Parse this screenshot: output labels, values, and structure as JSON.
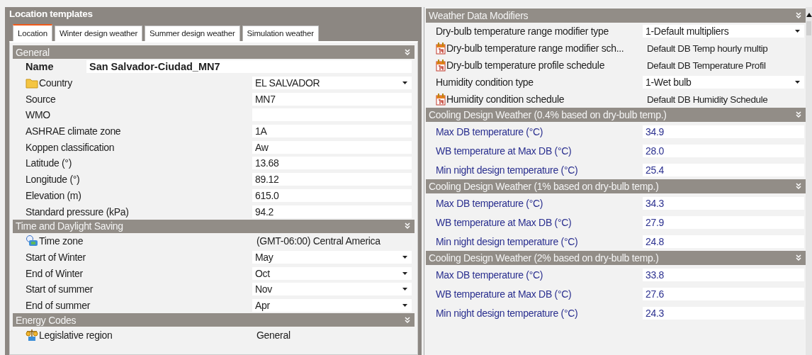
{
  "title": "Location templates",
  "tabs": [
    {
      "label": "Location",
      "selected": true
    },
    {
      "label": "Winter design weather",
      "selected": false
    },
    {
      "label": "Summer design weather",
      "selected": false
    },
    {
      "label": "Simulation weather",
      "selected": false
    }
  ],
  "left_sections": [
    {
      "title": "General",
      "rows": [
        {
          "kind": "name",
          "label": "Name",
          "value": "San Salvador-Ciudad_MN7"
        },
        {
          "kind": "folder-dropdown",
          "label": "Country",
          "value": "EL SALVADOR"
        },
        {
          "kind": "field",
          "label": "Source",
          "value": "MN7"
        },
        {
          "kind": "field",
          "label": "WMO"
        },
        {
          "kind": "field",
          "label": "ASHRAE climate zone",
          "value": "1A"
        },
        {
          "kind": "field",
          "label": "Koppen classification",
          "value": "Aw"
        },
        {
          "kind": "field",
          "label": "Latitude (°)",
          "value": "13.68"
        },
        {
          "kind": "field",
          "label": "Longitude (°)",
          "value": "89.12"
        },
        {
          "kind": "field",
          "label": "Elevation (m)",
          "value": "615.0"
        },
        {
          "kind": "field",
          "label": "Standard pressure (kPa)",
          "value": "94.2"
        }
      ]
    },
    {
      "title": "Time and Daylight Saving",
      "rows": [
        {
          "kind": "globe-text",
          "label": "Time zone",
          "value": "(GMT-06:00) Central America"
        },
        {
          "kind": "dropdown",
          "label": "Start of Winter",
          "value": "May"
        },
        {
          "kind": "dropdown",
          "label": "End of Winter",
          "value": "Oct"
        },
        {
          "kind": "dropdown",
          "label": "Start of summer",
          "value": "Nov"
        },
        {
          "kind": "dropdown",
          "label": "End of summer",
          "value": "Apr"
        }
      ]
    },
    {
      "title": "Energy Codes",
      "rows": [
        {
          "kind": "scales-text",
          "label": "Legislative region",
          "value": "General"
        }
      ]
    }
  ],
  "right_sections": [
    {
      "title": "Weather Data Modifiers",
      "rows": [
        {
          "kind": "dropdown",
          "label": "Dry-bulb temperature range modifier type",
          "value": "1-Default multipliers"
        },
        {
          "kind": "calendar-text",
          "label": "Dry-bulb temperature range modifier sch...",
          "value": "Default DB Temp hourly multip"
        },
        {
          "kind": "calendar-text",
          "label": "Dry-bulb temperature profile schedule",
          "value": "Default DB Temperature Profil"
        },
        {
          "kind": "dropdown",
          "label": "Humidity condition type",
          "value": "1-Wet bulb"
        },
        {
          "kind": "calendar-text",
          "label": "Humidity condition schedule",
          "value": "Default DB Humidity Schedule"
        }
      ]
    },
    {
      "title": "Cooling Design Weather (0.4% based on dry-bulb temp.)",
      "rows": [
        {
          "kind": "accent",
          "label": "Max DB temperature (°C)",
          "value": "34.9"
        },
        {
          "kind": "accent",
          "label": "WB temperature at Max DB (°C)",
          "value": "28.0"
        },
        {
          "kind": "accent",
          "label": "Min night design temperature (°C)",
          "value": "25.4"
        }
      ]
    },
    {
      "title": "Cooling Design Weather (1% based on dry-bulb temp.)",
      "rows": [
        {
          "kind": "accent",
          "label": "Max DB temperature (°C)",
          "value": "34.3"
        },
        {
          "kind": "accent",
          "label": "WB temperature at Max DB (°C)",
          "value": "27.9"
        },
        {
          "kind": "accent",
          "label": "Min night design temperature (°C)",
          "value": "24.8"
        }
      ]
    },
    {
      "title": "Cooling Design Weather (2% based on dry-bulb temp.)",
      "rows": [
        {
          "kind": "accent",
          "label": "Max DB temperature (°C)",
          "value": "33.8"
        },
        {
          "kind": "accent",
          "label": "WB temperature at Max DB (°C)",
          "value": "27.6"
        },
        {
          "kind": "accent",
          "label": "Min night design temperature (°C)",
          "value": "24.3"
        }
      ]
    }
  ]
}
